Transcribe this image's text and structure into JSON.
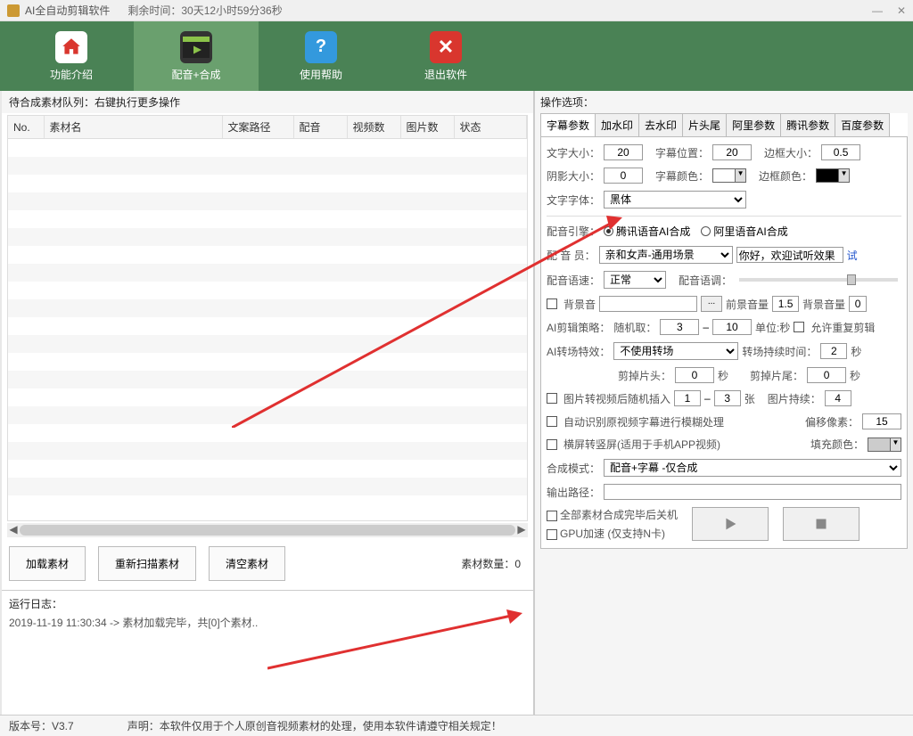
{
  "titlebar": {
    "title": "AI全自动剪辑软件",
    "countdown": "剩余时间：30天12小时59分36秒"
  },
  "toolbar": {
    "intro": "功能介绍",
    "compose": "配音+合成",
    "help": "使用帮助",
    "exit": "退出软件"
  },
  "left": {
    "queue_label": "待合成素材队列：右键执行更多操作",
    "cols": {
      "no": "No.",
      "name": "素材名",
      "path": "文案路径",
      "dub": "配音",
      "vcount": "视频数",
      "pcount": "图片数",
      "status": "状态"
    },
    "btn_load": "加载素材",
    "btn_rescan": "重新扫描素材",
    "btn_clear": "清空素材",
    "count_label": "素材数量：0",
    "log_title": "运行日志：",
    "log_line": "2019-11-19 11:30:34 -> 素材加载完毕，共[0]个素材.."
  },
  "right": {
    "ops_title": "操作选项：",
    "tabs": [
      "字幕参数",
      "加水印",
      "去水印",
      "片头尾",
      "阿里参数",
      "腾讯参数",
      "百度参数"
    ],
    "p": {
      "font_size_l": "文字大小：",
      "font_size": "20",
      "sub_pos_l": "字幕位置：",
      "sub_pos": "20",
      "border_l": "边框大小：",
      "border": "0.5",
      "shadow_l": "阴影大小：",
      "shadow": "0",
      "sub_color_l": "字幕颜色：",
      "border_color_l": "边框颜色：",
      "font_l": "文字字体：",
      "font": "黑体",
      "engine_l": "配音引擎：",
      "engine_t": "腾讯语音AI合成",
      "engine_a": "阿里语音AI合成",
      "voice_l": "配 音 员：",
      "voice": "亲和女声-通用场景",
      "voice_sample": "你好，欢迎试听效果",
      "try": "试",
      "speed_l": "配音语速：",
      "speed": "正常",
      "tone_l": "配音语调：",
      "bgm_l": "背景音",
      "fg_vol_l": "前景音量",
      "fg_vol": "1.5",
      "bg_vol_l": "背景音量",
      "bg_vol": "0",
      "strategy_l": "AI剪辑策略：",
      "rand_l": "随机取：",
      "rand_min": "3",
      "rand_max": "10",
      "unit_sec": "单位:秒",
      "allow_dup": "允许重复剪辑",
      "trans_l": "AI转场特效：",
      "trans": "不使用转场",
      "trans_dur_l": "转场持续时间：",
      "trans_dur": "2",
      "sec": "秒",
      "trim_head_l": "剪掉片头：",
      "trim_head": "0",
      "trim_tail_l": "剪掉片尾：",
      "trim_tail": "0",
      "img_insert_l": "图片转视频后随机插入",
      "img_min": "1",
      "img_max": "3",
      "sheet": "张",
      "img_dur_l": "图片持续：",
      "img_dur": "4",
      "auto_blur_l": "自动识别原视频字幕进行模糊处理",
      "offset_l": "偏移像素：",
      "offset": "15",
      "portrait_l": "横屏转竖屏(适用于手机APP视频)",
      "fill_l": "填充颜色：",
      "mode_l": "合成模式：",
      "mode": "配音+字幕 -仅合成",
      "out_l": "输出路径：",
      "shutdown_l": "全部素材合成完毕后关机",
      "gpu_l": "GPU加速 (仅支持N卡)"
    }
  },
  "status": {
    "version_l": "版本号：V3.7",
    "disclaimer": "声明：本软件仅用于个人原创音视频素材的处理，使用本软件请遵守相关规定！"
  }
}
